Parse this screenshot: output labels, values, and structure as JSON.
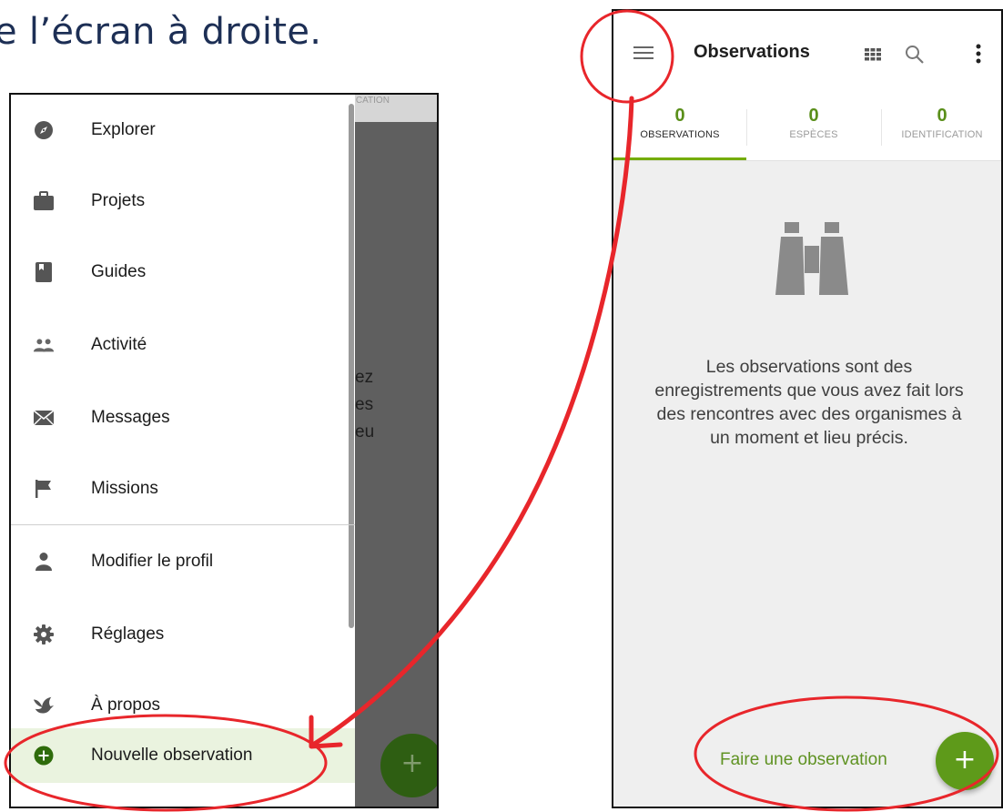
{
  "heading": "e l’écran à droite.",
  "colors": {
    "accent": "#74ac00",
    "accent_dark": "#5e9a1a",
    "annotation": "#e8262b",
    "drawer_active": "#eaf3df"
  },
  "left_phone": {
    "bg_tab_text": "FICATION",
    "bg_text_lines": [
      "ez",
      "es",
      "eu"
    ],
    "bg_fab": "+",
    "menu": [
      {
        "label": "Explorer",
        "icon": "compass-icon"
      },
      {
        "label": "Projets",
        "icon": "briefcase-icon"
      },
      {
        "label": "Guides",
        "icon": "book-icon"
      },
      {
        "label": "Activité",
        "icon": "people-icon"
      },
      {
        "label": "Messages",
        "icon": "envelope-icon"
      },
      {
        "label": "Missions",
        "icon": "flag-icon"
      },
      {
        "label": "Modifier le profil",
        "icon": "person-icon"
      },
      {
        "label": "Réglages",
        "icon": "gear-icon"
      },
      {
        "label": "À propos",
        "icon": "bird-icon"
      },
      {
        "label": "Nouvelle observation",
        "icon": "add-circle-icon",
        "active": true
      }
    ]
  },
  "right_phone": {
    "title": "Observations",
    "icons": [
      "menu-icon",
      "grid-icon",
      "search-icon",
      "more-vert-icon"
    ],
    "tabs": [
      {
        "count": "0",
        "label": "OBSERVATIONS",
        "active": true
      },
      {
        "count": "0",
        "label": "ESPÈCES"
      },
      {
        "count": "0",
        "label": "IDENTIFICATION"
      }
    ],
    "empty_icon": "binoculars-icon",
    "empty_message": "Les observations sont des enregistrements que vous avez fait lors des rencontres avec des organismes à un moment et lieu précis.",
    "cta_label": "Faire une observation",
    "fab": "+"
  }
}
